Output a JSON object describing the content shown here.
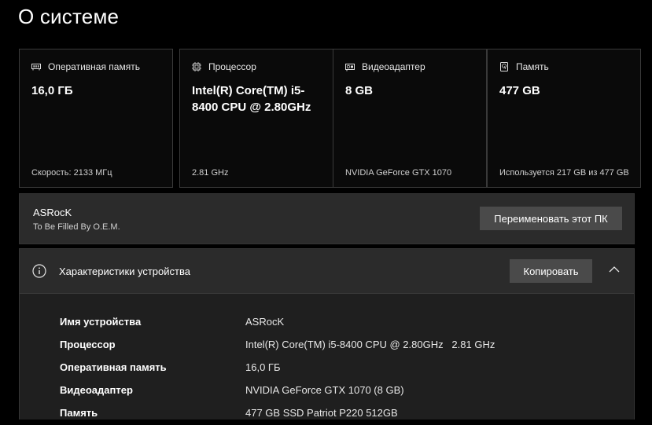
{
  "page": {
    "title": "О системе"
  },
  "cards": [
    {
      "icon": "ram-icon",
      "label": "Оперативная память",
      "value": "16,0 ГБ",
      "footer": "Скорость: 2133 МГц"
    },
    {
      "icon": "cpu-icon",
      "label": "Процессор",
      "value": "Intel(R) Core(TM) i5-8400 CPU @ 2.80GHz",
      "footer": "2.81 GHz"
    },
    {
      "icon": "gpu-icon",
      "label": "Видеоадаптер",
      "value": "8 GB",
      "footer": "NVIDIA GeForce GTX 1070"
    },
    {
      "icon": "storage-icon",
      "label": "Память",
      "value": "477 GB",
      "footer": "Используется 217 GB из 477 GB"
    }
  ],
  "pc": {
    "name": "ASRocK",
    "model": "To Be Filled By O.E.M.",
    "rename_label": "Переименовать этот ПК"
  },
  "specs": {
    "icon": "info-icon",
    "title": "Характеристики устройства",
    "copy_label": "Копировать",
    "collapse_icon": "chevron-up-icon",
    "rows": [
      {
        "key": "Имя устройства",
        "value": "ASRocK"
      },
      {
        "key": "Процессор",
        "value": "Intel(R) Core(TM) i5-8400 CPU @ 2.80GHz   2.81 GHz"
      },
      {
        "key": "Оперативная память",
        "value": "16,0 ГБ"
      },
      {
        "key": "Видеоадаптер",
        "value": "NVIDIA GeForce GTX 1070 (8 GB)"
      },
      {
        "key": "Память",
        "value": "477 GB SSD Patriot P220 512GB"
      }
    ]
  },
  "colors": {
    "background": "#000000",
    "card_border": "#3a3a3a",
    "panel": "#2b2b2b",
    "button": "#4a4a4a"
  }
}
